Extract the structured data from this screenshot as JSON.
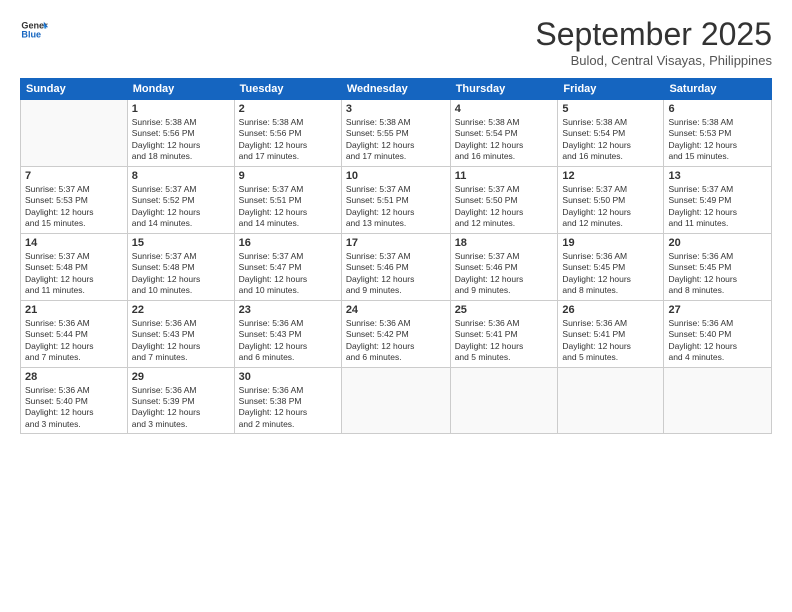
{
  "header": {
    "logo_line1": "General",
    "logo_line2": "Blue",
    "month": "September 2025",
    "location": "Bulod, Central Visayas, Philippines"
  },
  "weekdays": [
    "Sunday",
    "Monday",
    "Tuesday",
    "Wednesday",
    "Thursday",
    "Friday",
    "Saturday"
  ],
  "weeks": [
    [
      {
        "day": "",
        "info": ""
      },
      {
        "day": "1",
        "info": "Sunrise: 5:38 AM\nSunset: 5:56 PM\nDaylight: 12 hours\nand 18 minutes."
      },
      {
        "day": "2",
        "info": "Sunrise: 5:38 AM\nSunset: 5:56 PM\nDaylight: 12 hours\nand 17 minutes."
      },
      {
        "day": "3",
        "info": "Sunrise: 5:38 AM\nSunset: 5:55 PM\nDaylight: 12 hours\nand 17 minutes."
      },
      {
        "day": "4",
        "info": "Sunrise: 5:38 AM\nSunset: 5:54 PM\nDaylight: 12 hours\nand 16 minutes."
      },
      {
        "day": "5",
        "info": "Sunrise: 5:38 AM\nSunset: 5:54 PM\nDaylight: 12 hours\nand 16 minutes."
      },
      {
        "day": "6",
        "info": "Sunrise: 5:38 AM\nSunset: 5:53 PM\nDaylight: 12 hours\nand 15 minutes."
      }
    ],
    [
      {
        "day": "7",
        "info": "Sunrise: 5:37 AM\nSunset: 5:53 PM\nDaylight: 12 hours\nand 15 minutes."
      },
      {
        "day": "8",
        "info": "Sunrise: 5:37 AM\nSunset: 5:52 PM\nDaylight: 12 hours\nand 14 minutes."
      },
      {
        "day": "9",
        "info": "Sunrise: 5:37 AM\nSunset: 5:51 PM\nDaylight: 12 hours\nand 14 minutes."
      },
      {
        "day": "10",
        "info": "Sunrise: 5:37 AM\nSunset: 5:51 PM\nDaylight: 12 hours\nand 13 minutes."
      },
      {
        "day": "11",
        "info": "Sunrise: 5:37 AM\nSunset: 5:50 PM\nDaylight: 12 hours\nand 12 minutes."
      },
      {
        "day": "12",
        "info": "Sunrise: 5:37 AM\nSunset: 5:50 PM\nDaylight: 12 hours\nand 12 minutes."
      },
      {
        "day": "13",
        "info": "Sunrise: 5:37 AM\nSunset: 5:49 PM\nDaylight: 12 hours\nand 11 minutes."
      }
    ],
    [
      {
        "day": "14",
        "info": "Sunrise: 5:37 AM\nSunset: 5:48 PM\nDaylight: 12 hours\nand 11 minutes."
      },
      {
        "day": "15",
        "info": "Sunrise: 5:37 AM\nSunset: 5:48 PM\nDaylight: 12 hours\nand 10 minutes."
      },
      {
        "day": "16",
        "info": "Sunrise: 5:37 AM\nSunset: 5:47 PM\nDaylight: 12 hours\nand 10 minutes."
      },
      {
        "day": "17",
        "info": "Sunrise: 5:37 AM\nSunset: 5:46 PM\nDaylight: 12 hours\nand 9 minutes."
      },
      {
        "day": "18",
        "info": "Sunrise: 5:37 AM\nSunset: 5:46 PM\nDaylight: 12 hours\nand 9 minutes."
      },
      {
        "day": "19",
        "info": "Sunrise: 5:36 AM\nSunset: 5:45 PM\nDaylight: 12 hours\nand 8 minutes."
      },
      {
        "day": "20",
        "info": "Sunrise: 5:36 AM\nSunset: 5:45 PM\nDaylight: 12 hours\nand 8 minutes."
      }
    ],
    [
      {
        "day": "21",
        "info": "Sunrise: 5:36 AM\nSunset: 5:44 PM\nDaylight: 12 hours\nand 7 minutes."
      },
      {
        "day": "22",
        "info": "Sunrise: 5:36 AM\nSunset: 5:43 PM\nDaylight: 12 hours\nand 7 minutes."
      },
      {
        "day": "23",
        "info": "Sunrise: 5:36 AM\nSunset: 5:43 PM\nDaylight: 12 hours\nand 6 minutes."
      },
      {
        "day": "24",
        "info": "Sunrise: 5:36 AM\nSunset: 5:42 PM\nDaylight: 12 hours\nand 6 minutes."
      },
      {
        "day": "25",
        "info": "Sunrise: 5:36 AM\nSunset: 5:41 PM\nDaylight: 12 hours\nand 5 minutes."
      },
      {
        "day": "26",
        "info": "Sunrise: 5:36 AM\nSunset: 5:41 PM\nDaylight: 12 hours\nand 5 minutes."
      },
      {
        "day": "27",
        "info": "Sunrise: 5:36 AM\nSunset: 5:40 PM\nDaylight: 12 hours\nand 4 minutes."
      }
    ],
    [
      {
        "day": "28",
        "info": "Sunrise: 5:36 AM\nSunset: 5:40 PM\nDaylight: 12 hours\nand 3 minutes."
      },
      {
        "day": "29",
        "info": "Sunrise: 5:36 AM\nSunset: 5:39 PM\nDaylight: 12 hours\nand 3 minutes."
      },
      {
        "day": "30",
        "info": "Sunrise: 5:36 AM\nSunset: 5:38 PM\nDaylight: 12 hours\nand 2 minutes."
      },
      {
        "day": "",
        "info": ""
      },
      {
        "day": "",
        "info": ""
      },
      {
        "day": "",
        "info": ""
      },
      {
        "day": "",
        "info": ""
      }
    ]
  ]
}
